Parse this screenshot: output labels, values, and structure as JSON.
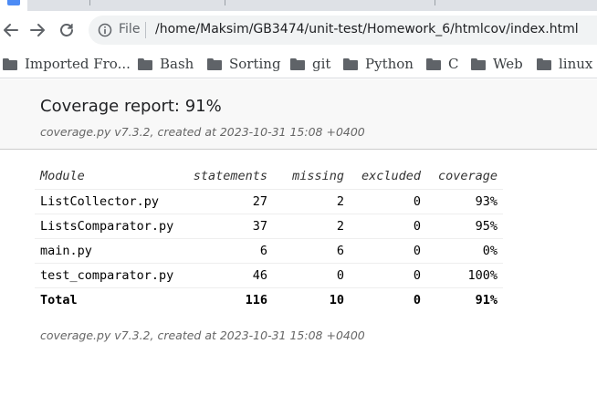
{
  "browser": {
    "address": {
      "scheme": "File",
      "url": "/home/Maksim/GB3474/unit-test/Homework_6/htmlcov/index.html"
    },
    "bookmarks": [
      "Imported Fro...",
      "Bash",
      "Sorting",
      "git",
      "Python",
      "C",
      "Web",
      "linux"
    ]
  },
  "report": {
    "title": "Coverage report: 91%",
    "meta": "coverage.py v7.3.2, created at 2023-10-31 15:08 +0400",
    "footer_meta": "coverage.py v7.3.2, created at 2023-10-31 15:08 +0400",
    "columns": [
      "Module",
      "statements",
      "missing",
      "excluded",
      "coverage"
    ],
    "rows": [
      [
        "ListCollector.py",
        "27",
        "2",
        "0",
        "93%"
      ],
      [
        "ListsComparator.py",
        "37",
        "2",
        "0",
        "95%"
      ],
      [
        "main.py",
        "6",
        "6",
        "0",
        "0%"
      ],
      [
        "test_comparator.py",
        "46",
        "0",
        "0",
        "100%"
      ]
    ],
    "total": [
      "Total",
      "116",
      "10",
      "0",
      "91%"
    ]
  },
  "colors": {
    "header_bg": "#f8f8f8",
    "link": "#0000ee",
    "muted": "#666666"
  }
}
